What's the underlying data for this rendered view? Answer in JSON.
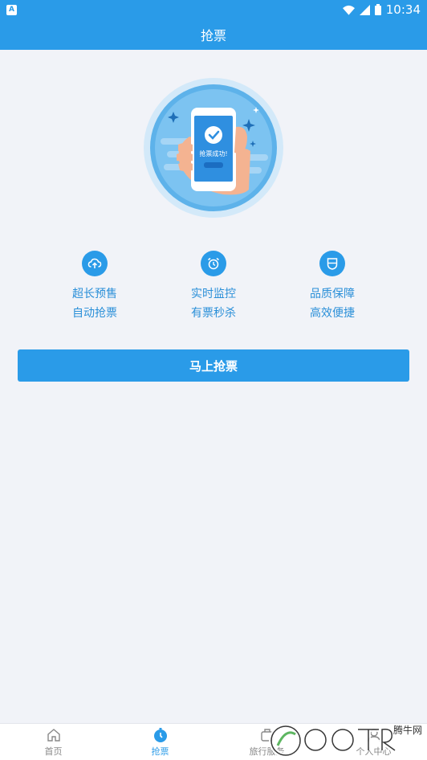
{
  "status_bar": {
    "time": "10:34",
    "icons": [
      "app-badge-icon",
      "wifi-icon",
      "signal-icon",
      "battery-icon"
    ]
  },
  "header": {
    "title": "抢票"
  },
  "features": [
    {
      "icon": "cloud-upload-icon",
      "line1": "超长预售",
      "line2": "自动抢票"
    },
    {
      "icon": "alarm-clock-icon",
      "line1": "实时监控",
      "line2": "有票秒杀"
    },
    {
      "icon": "shield-icon",
      "line1": "品质保障",
      "line2": "高效便捷"
    }
  ],
  "main": {
    "grab_button_label": "马上抢票"
  },
  "hero": {
    "phone_text": "抢票成功!"
  },
  "bottom_nav": {
    "items": [
      {
        "label": "首页",
        "icon": "home-icon",
        "active": false
      },
      {
        "label": "抢票",
        "icon": "ticket-icon",
        "active": true
      },
      {
        "label": "旅行服务",
        "icon": "travel-service-icon",
        "active": false
      },
      {
        "label": "个人中心",
        "icon": "person-icon",
        "active": false
      }
    ]
  },
  "watermark": {
    "text": "腾牛网"
  },
  "colors": {
    "primary": "#2a9be8",
    "background": "#f1f3f8",
    "feature_text": "#2a8fd8",
    "nav_inactive": "#888888"
  }
}
